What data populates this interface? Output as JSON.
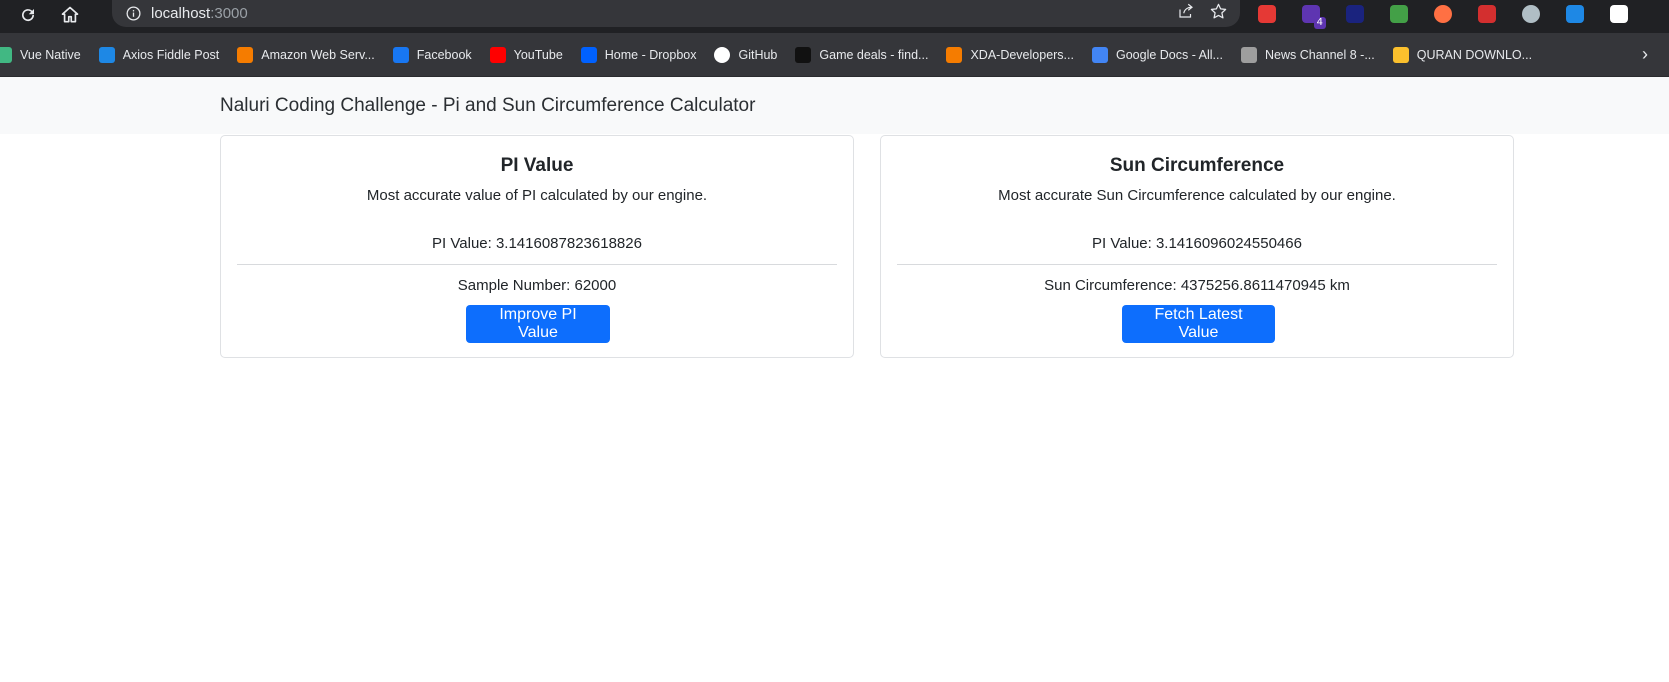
{
  "browser": {
    "url_host": "localhost",
    "url_port": ":3000",
    "bookmarks": [
      {
        "label": "Vue Native",
        "icon": "vue-icon",
        "color": "#41b883"
      },
      {
        "label": "Axios Fiddle Post",
        "icon": "cloud-icon",
        "color": "#1e88e5"
      },
      {
        "label": "Amazon Web Serv...",
        "icon": "aws-icon",
        "color": "#f57c00"
      },
      {
        "label": "Facebook",
        "icon": "facebook-icon",
        "color": "#1877f2"
      },
      {
        "label": "YouTube",
        "icon": "youtube-icon",
        "color": "#ff0000"
      },
      {
        "label": "Home - Dropbox",
        "icon": "dropbox-icon",
        "color": "#0061ff"
      },
      {
        "label": "GitHub",
        "icon": "github-icon",
        "color": "#ffffff"
      },
      {
        "label": "Game deals - find...",
        "icon": "gg-icon",
        "color": "#111111"
      },
      {
        "label": "XDA-Developers...",
        "icon": "xda-icon",
        "color": "#f57c00"
      },
      {
        "label": "Google Docs - All...",
        "icon": "docs-icon",
        "color": "#4285f4"
      },
      {
        "label": "News Channel 8 -...",
        "icon": "news-icon",
        "color": "#9e9e9e"
      },
      {
        "label": "QURAN DOWNLO...",
        "icon": "quran-icon",
        "color": "#fbc02d"
      }
    ],
    "extensions": [
      {
        "icon": "adblock-icon",
        "color": "#e53935"
      },
      {
        "icon": "purple-extension-icon",
        "color": "#5e35b1",
        "badge": "4"
      },
      {
        "icon": "dark-blue-extension-icon",
        "color": "#1a237e"
      },
      {
        "icon": "colorful-extension-icon",
        "color": "#43a047"
      },
      {
        "icon": "capsule-extension-icon",
        "color": "#ff7043"
      },
      {
        "icon": "red-box-extension-icon",
        "color": "#d32f2f"
      },
      {
        "icon": "gray-circle-extension-icon",
        "color": "#b0bec5"
      },
      {
        "icon": "shield-extension-icon",
        "color": "#1e88e5"
      },
      {
        "icon": "puzzle-extension-icon",
        "color": "#ffffff"
      }
    ]
  },
  "navbar": {
    "brand": "Naluri Coding Challenge - Pi and Sun Circumference Calculator"
  },
  "pi_card": {
    "title": "PI Value",
    "description": "Most accurate value of PI calculated by our engine.",
    "value_text": "PI Value: 3.1416087823618826",
    "sample_text": "Sample Number: 62000",
    "button_label": "Improve PI Value"
  },
  "sun_card": {
    "title": "Sun Circumference",
    "description": "Most accurate Sun Circumference calculated by our engine.",
    "value_text": "PI Value: 3.1416096024550466",
    "circumference_text": "Sun Circumference: 4375256.8611470945 km",
    "button_label": "Fetch Latest Value"
  },
  "colors": {
    "primary_button": "#0d6efd",
    "navbar_bg": "#f8f9fa"
  }
}
